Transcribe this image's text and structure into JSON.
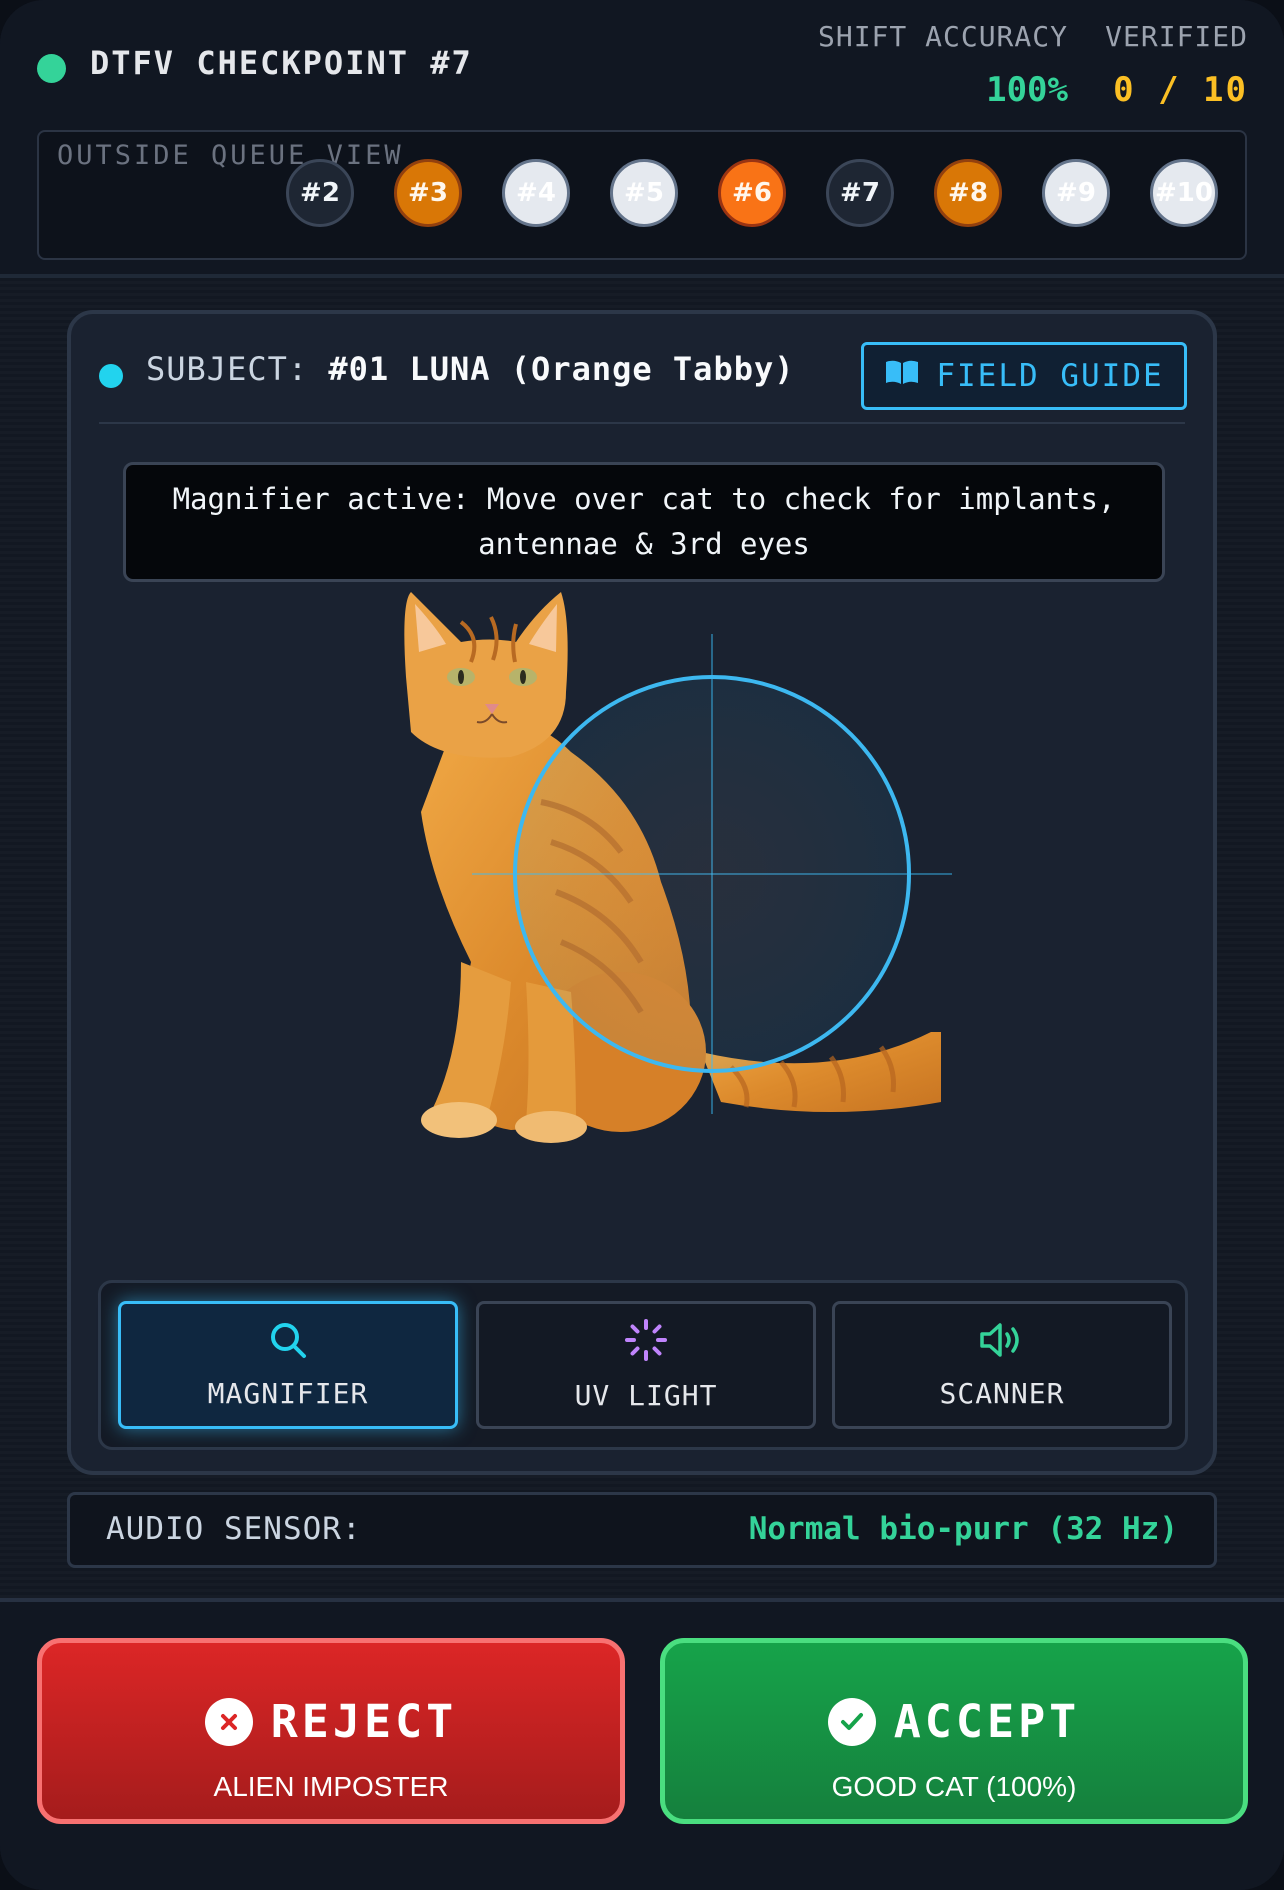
{
  "header": {
    "checkpoint_title": "DTFV CHECKPOINT #7",
    "accuracy_label": "SHIFT ACCURACY",
    "accuracy_value": "100%",
    "verified_label": "VERIFIED",
    "verified_value": "0 / 10",
    "status_color": "#34d399"
  },
  "queue": {
    "label": "OUTSIDE QUEUE VIEW",
    "items": [
      {
        "label": "#2",
        "style": "dark"
      },
      {
        "label": "#3",
        "style": "amber"
      },
      {
        "label": "#4",
        "style": "white"
      },
      {
        "label": "#5",
        "style": "white"
      },
      {
        "label": "#6",
        "style": "orange"
      },
      {
        "label": "#7",
        "style": "dark"
      },
      {
        "label": "#8",
        "style": "amber"
      },
      {
        "label": "#9",
        "style": "white"
      },
      {
        "label": "#10",
        "style": "white"
      }
    ]
  },
  "subject": {
    "prefix": "SUBJECT:",
    "name": "#01 LUNA (Orange Tabby)"
  },
  "field_guide": {
    "label": "FIELD GUIDE",
    "icon": "book-open-icon"
  },
  "hint": {
    "text": "Magnifier active: Move over cat to check for implants, antennae & 3rd eyes"
  },
  "tools": [
    {
      "label": "MAGNIFIER",
      "icon": "search-icon",
      "active": true
    },
    {
      "label": "UV LIGHT",
      "icon": "uv-light-icon",
      "active": false
    },
    {
      "label": "SCANNER",
      "icon": "speaker-icon",
      "active": false
    }
  ],
  "audio": {
    "label": "AUDIO SENSOR:",
    "value": "Normal bio-purr (32 Hz)"
  },
  "actions": {
    "reject_label": "REJECT",
    "reject_sub": "ALIEN IMPOSTER",
    "accept_label": "ACCEPT",
    "accept_sub": "GOOD CAT (100%)"
  },
  "colors": {
    "accent": "#38bdf8",
    "success": "#34d399",
    "warning": "#fbbf24",
    "reject": "#dc2626",
    "accept": "#16a34a"
  }
}
